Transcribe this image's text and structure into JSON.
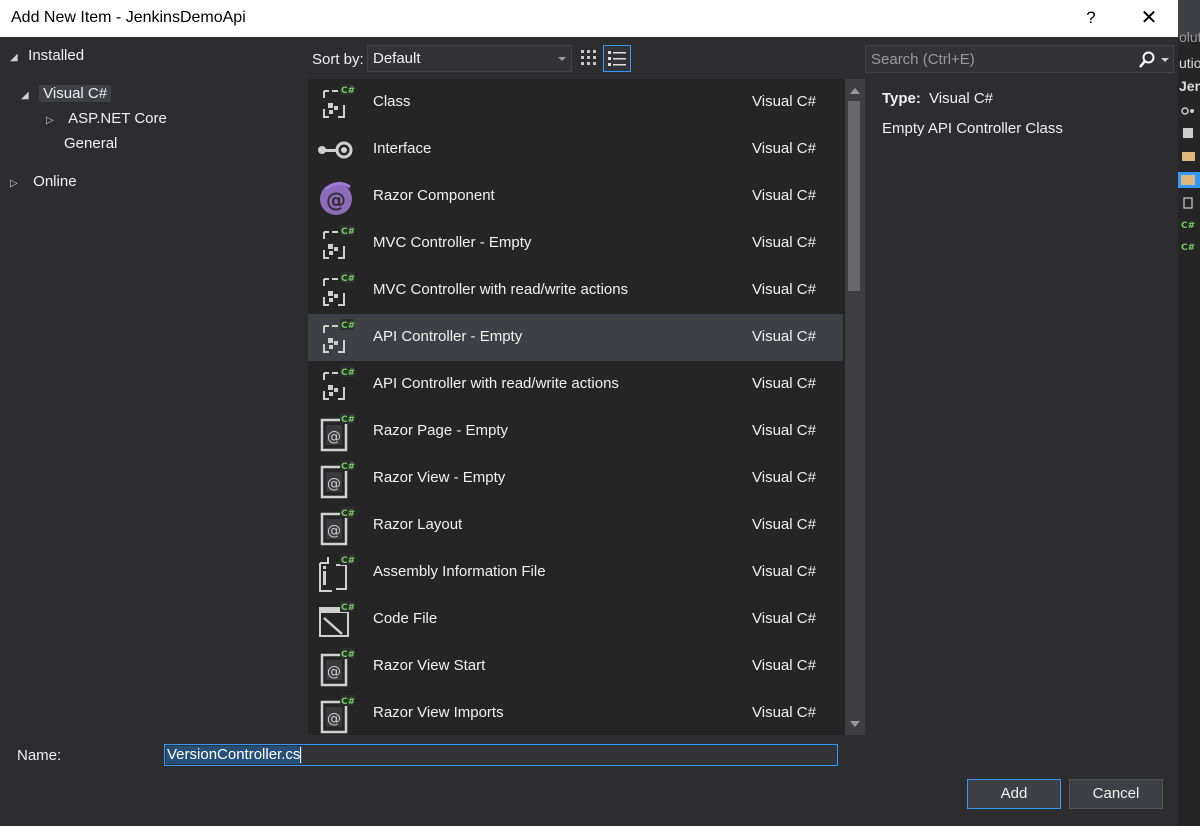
{
  "window": {
    "title": "Add New Item - JenkinsDemoApi",
    "help_label": "?",
    "close_label": "✕"
  },
  "tree": {
    "installed": "Installed",
    "visual_csharp": "Visual C#",
    "aspnet_core": "ASP.NET Core",
    "general": "General",
    "online": "Online"
  },
  "toolbar": {
    "sort_label": "Sort by:",
    "sort_value": "Default"
  },
  "search": {
    "placeholder": "Search (Ctrl+E)"
  },
  "templates": [
    {
      "name": "Class",
      "lang": "Visual C#",
      "icon": "class-icon"
    },
    {
      "name": "Interface",
      "lang": "Visual C#",
      "icon": "interface-icon"
    },
    {
      "name": "Razor Component",
      "lang": "Visual C#",
      "icon": "razor-component-icon"
    },
    {
      "name": "MVC Controller - Empty",
      "lang": "Visual C#",
      "icon": "controller-icon"
    },
    {
      "name": "MVC Controller with read/write actions",
      "lang": "Visual C#",
      "icon": "controller-icon"
    },
    {
      "name": "API Controller - Empty",
      "lang": "Visual C#",
      "icon": "controller-icon",
      "selected": true
    },
    {
      "name": "API Controller with read/write actions",
      "lang": "Visual C#",
      "icon": "controller-icon"
    },
    {
      "name": "Razor Page - Empty",
      "lang": "Visual C#",
      "icon": "razor-page-icon"
    },
    {
      "name": "Razor View - Empty",
      "lang": "Visual C#",
      "icon": "razor-page-icon"
    },
    {
      "name": "Razor Layout",
      "lang": "Visual C#",
      "icon": "razor-page-icon"
    },
    {
      "name": "Assembly Information File",
      "lang": "Visual C#",
      "icon": "assembly-info-icon"
    },
    {
      "name": "Code File",
      "lang": "Visual C#",
      "icon": "code-file-icon"
    },
    {
      "name": "Razor View Start",
      "lang": "Visual C#",
      "icon": "razor-page-icon"
    },
    {
      "name": "Razor View Imports",
      "lang": "Visual C#",
      "icon": "razor-page-icon"
    }
  ],
  "details": {
    "type_label": "Type:",
    "type_value": "Visual C#",
    "description": "Empty API Controller Class"
  },
  "footer": {
    "name_label": "Name:",
    "name_value": "VersionController.cs",
    "add_label": "Add",
    "cancel_label": "Cancel"
  },
  "behind": {
    "line1": "olutio",
    "line2": "utio",
    "line3": "Jen"
  },
  "colors": {
    "accent": "#3399ff",
    "csharp_badge": "#6fcf5a",
    "razor_purple": "#a078d6"
  }
}
